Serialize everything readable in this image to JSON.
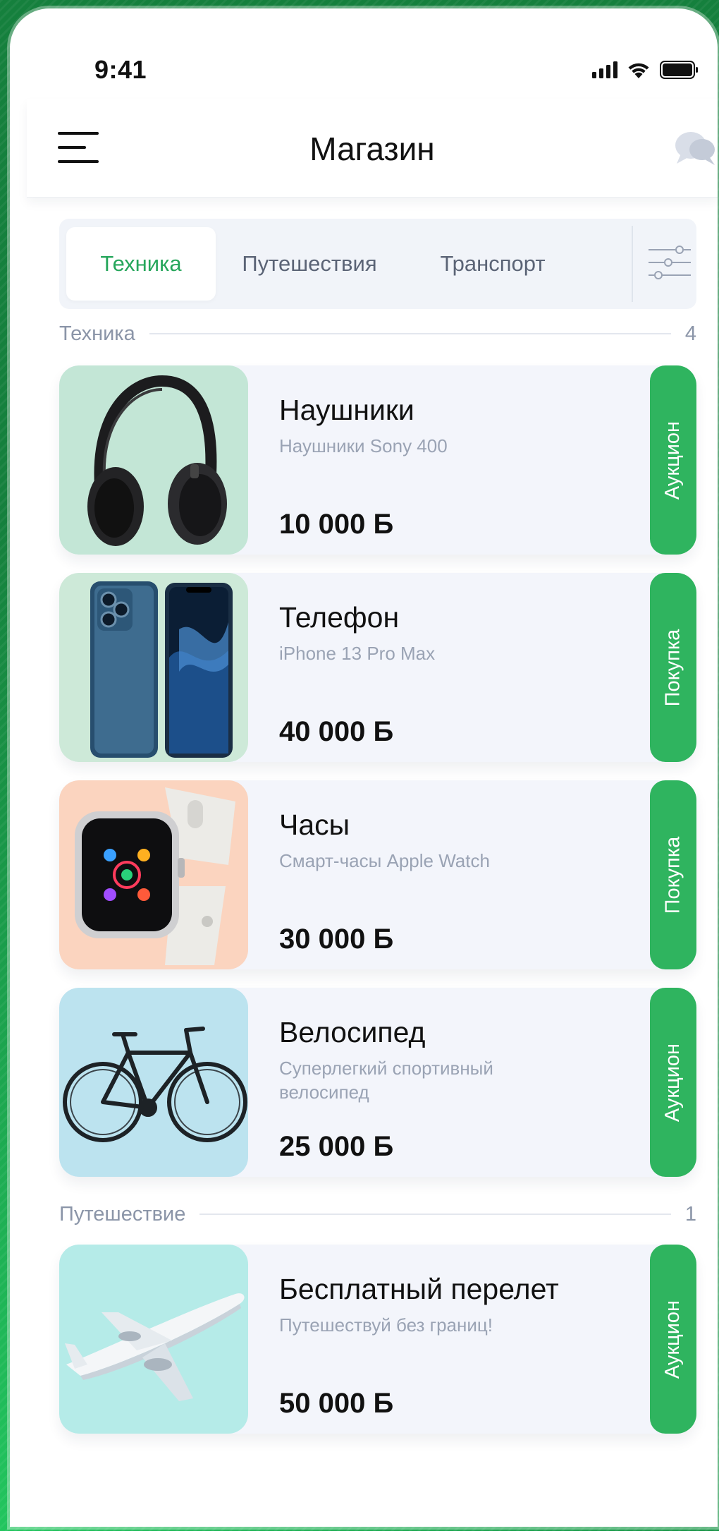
{
  "status_bar": {
    "time": "9:41"
  },
  "header": {
    "title": "Магазин"
  },
  "tabs": [
    {
      "label": "Техника",
      "active": true
    },
    {
      "label": "Путешествия",
      "active": false
    },
    {
      "label": "Транспорт",
      "active": false
    }
  ],
  "sections": [
    {
      "title": "Техника",
      "count": "4",
      "items": [
        {
          "title": "Наушники",
          "subtitle": "Наушники Sony 400",
          "price": "10 000 Б",
          "badge": "Аукцион",
          "image": "headphones"
        },
        {
          "title": "Телефон",
          "subtitle": "iPhone 13 Pro Max",
          "price": "40 000 Б",
          "badge": "Покупка",
          "image": "phone"
        },
        {
          "title": "Часы",
          "subtitle": "Смарт-часы Apple Watch",
          "price": "30 000 Б",
          "badge": "Покупка",
          "image": "watch"
        },
        {
          "title": "Велосипед",
          "subtitle": "Суперлегкий спортивный велосипед",
          "price": "25 000 Б",
          "badge": "Аукцион",
          "image": "bicycle"
        }
      ]
    },
    {
      "title": "Путешествие",
      "count": "1",
      "items": [
        {
          "title": "Бесплатный перелет",
          "subtitle": "Путешествуй без границ!",
          "price": "50 000 Б",
          "badge": "Аукцион",
          "image": "airplane"
        }
      ]
    }
  ],
  "colors": {
    "accent": "#2fb45f",
    "background": "#16a34a",
    "card": "#f3f5fb",
    "image_backgrounds": [
      "#c3e6d6",
      "#cde9d8",
      "#fbd4bf",
      "#bce3ef",
      "#b5ebe8"
    ]
  },
  "icons": [
    "menu-icon",
    "chat-icon",
    "filter-icon",
    "signal-icon",
    "wifi-icon",
    "battery-icon"
  ]
}
